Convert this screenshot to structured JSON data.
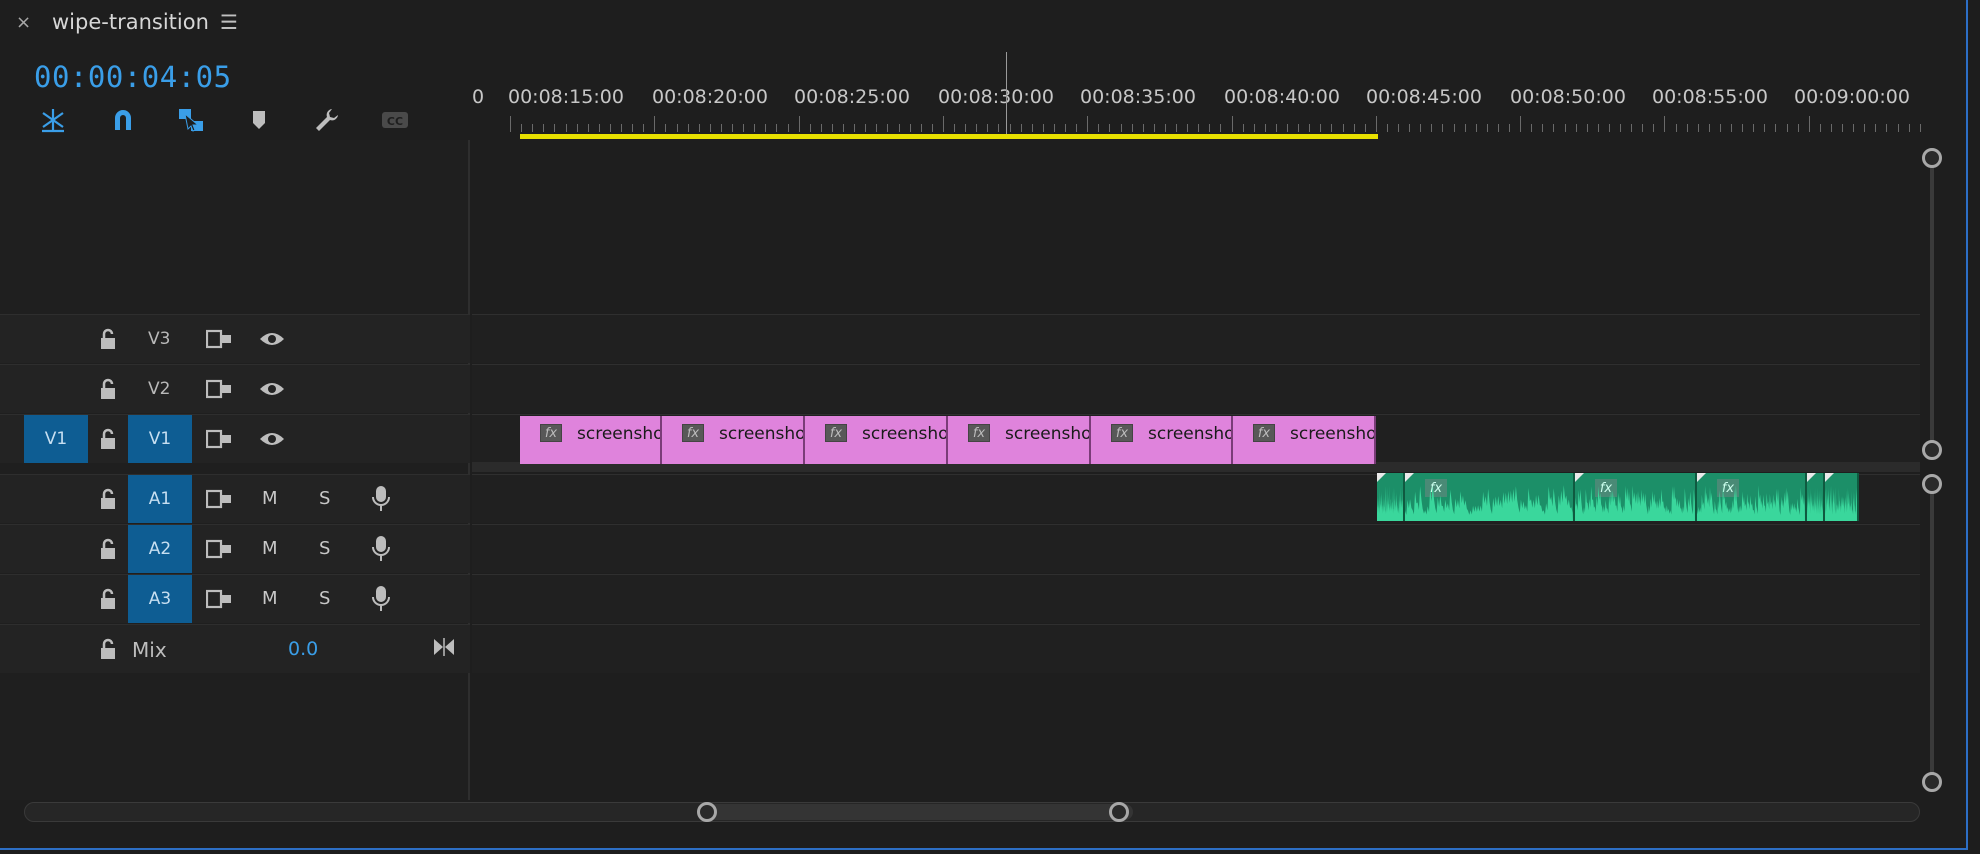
{
  "panel": {
    "close_glyph": "×",
    "title": "wipe-transition",
    "menu_glyph": "☰",
    "timecode": "00:00:04:05"
  },
  "toolbar": [
    {
      "name": "insert-overwrite-sequences-icon"
    },
    {
      "name": "snap-magnet-icon"
    },
    {
      "name": "linked-selection-icon"
    },
    {
      "name": "add-marker-icon"
    },
    {
      "name": "timeline-settings-wrench-icon"
    },
    {
      "name": "captions-cc-icon"
    }
  ],
  "ruler": {
    "first_label": "0",
    "labels": [
      "00:08:15:00",
      "00:08:20:00",
      "00:08:25:00",
      "00:08:30:00",
      "00:08:35:00",
      "00:08:40:00",
      "00:08:45:00",
      "00:08:50:00",
      "00:08:55:00",
      "00:09:00:00"
    ]
  },
  "video_tracks": [
    {
      "name": "V3",
      "targeted": false
    },
    {
      "name": "V2",
      "targeted": false
    },
    {
      "name": "V1",
      "targeted": true,
      "source": "V1"
    }
  ],
  "audio_tracks": [
    {
      "name": "A1",
      "mute": "M",
      "solo": "S"
    },
    {
      "name": "A2",
      "mute": "M",
      "solo": "S"
    },
    {
      "name": "A3",
      "mute": "M",
      "solo": "S"
    }
  ],
  "mix": {
    "label": "Mix",
    "value": "0.0"
  },
  "video_clips": [
    {
      "label": "screensho"
    },
    {
      "label": "screensho"
    },
    {
      "label": "screensho"
    },
    {
      "label": "screensho"
    },
    {
      "label": "screensho"
    },
    {
      "label": "screensho"
    }
  ],
  "fx_glyph": "fx",
  "colors": {
    "accent": "#3a9ee8",
    "video_clip": "#df83dc",
    "audio_clip": "#1c8f68",
    "work_area": "#e8e000",
    "target_patch": "#0e5d93"
  }
}
